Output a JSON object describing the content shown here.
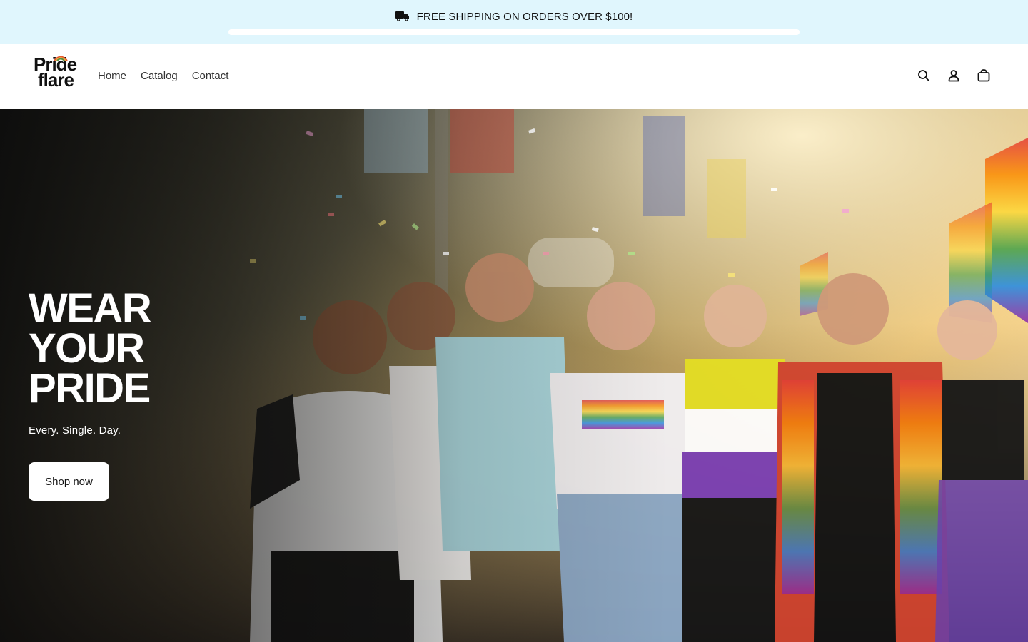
{
  "announcement": {
    "text": "FREE SHIPPING ON ORDERS OVER $100!",
    "icon": "truck-icon",
    "progress_fraction": 0
  },
  "header": {
    "logo": {
      "line1": "Pride",
      "line2": "flare"
    },
    "nav": [
      {
        "label": "Home"
      },
      {
        "label": "Catalog"
      },
      {
        "label": "Contact"
      }
    ],
    "icons": [
      "search-icon",
      "account-icon",
      "cart-icon"
    ]
  },
  "hero": {
    "title_lines": [
      "WEAR",
      "YOUR",
      "PRIDE"
    ],
    "subtitle": "Every. Single. Day.",
    "button_label": "Shop now"
  },
  "colors": {
    "announcement_bg": "#e0f6fd",
    "header_bg": "#ffffff",
    "button_bg": "#ffffff",
    "hero_text": "#ffffff"
  }
}
